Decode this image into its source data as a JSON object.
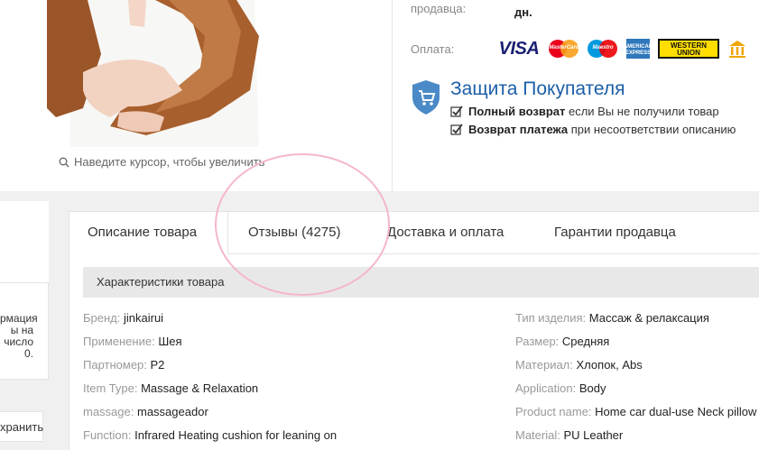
{
  "product": {
    "zoom_hint": "Наведите курсор, чтобы увеличить"
  },
  "seller": {
    "label": "продавца:",
    "value": "дн."
  },
  "payment": {
    "label": "Оплата:",
    "logos": [
      "VISA",
      "MasterCard",
      "Maestro",
      "AMERICAN EXPRESS",
      "WESTERN UNION",
      "bank"
    ]
  },
  "buyer_protection": {
    "title": "Защита Покупателя",
    "line1_bold": "Полный возврат",
    "line1_rest": "если Вы не получили товар",
    "line2_bold": "Возврат платежа",
    "line2_rest": "при несоответствии описанию"
  },
  "left_column": {
    "text_lines": [
      "рмация",
      "ы на",
      "число",
      "0."
    ],
    "save_label": "хранить"
  },
  "tabs": [
    {
      "label": "Описание товара",
      "active": true
    },
    {
      "label": "Отзывы (4275)",
      "active": false
    },
    {
      "label": "Доставка и оплата",
      "active": false
    },
    {
      "label": "Гарантии продавца",
      "active": false
    }
  ],
  "specs_header": "Характеристики товара",
  "specs_left": [
    {
      "key": "Бренд:",
      "value": "jinkairui"
    },
    {
      "key": "Применение:",
      "value": "Шея"
    },
    {
      "key": "Партномер:",
      "value": "P2"
    },
    {
      "key": "Item Type:",
      "value": "Massage & Relaxation"
    },
    {
      "key": "massage:",
      "value": "massageador"
    },
    {
      "key": "Function:",
      "value": "Infrared Heating cushion for leaning on"
    }
  ],
  "specs_right": [
    {
      "key": "Тип изделия:",
      "value": "Массаж & релаксация"
    },
    {
      "key": "Размер:",
      "value": "Средняя"
    },
    {
      "key": "Материал:",
      "value": "Хлопок, Abs"
    },
    {
      "key": "Application:",
      "value": "Body"
    },
    {
      "key": "Product name:",
      "value": "Home car dual-use Neck pillow"
    },
    {
      "key": "Material:",
      "value": "PU Leather"
    }
  ],
  "colors": {
    "accent_blue": "#1b5ea8",
    "band_grey": "#f0f0f0",
    "annotation_pink": "#f4b6cf"
  }
}
